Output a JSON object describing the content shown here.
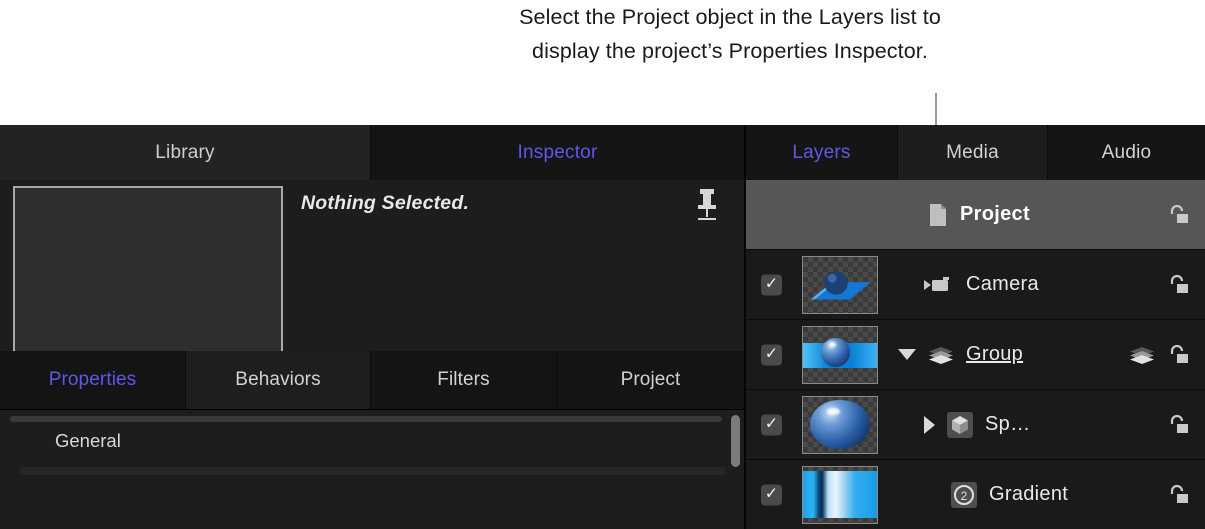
{
  "callout": {
    "text": "Select the Project object in the Layers list to display the project’s Properties Inspector."
  },
  "left_pane": {
    "top_tabs": [
      {
        "label": "Library",
        "active": false
      },
      {
        "label": "Inspector",
        "active": true
      }
    ],
    "inspector": {
      "status_text": "Nothing Selected.",
      "pin_icon": "pushpin-icon",
      "preview_placeholder": ""
    },
    "bottom_tabs": [
      {
        "label": "Properties",
        "active": true
      },
      {
        "label": "Behaviors",
        "active": false
      },
      {
        "label": "Filters",
        "active": false
      },
      {
        "label": "Project",
        "active": false
      }
    ],
    "properties_panel": {
      "section_label": "General"
    }
  },
  "right_pane": {
    "tabs": [
      {
        "label": "Layers",
        "active": true
      },
      {
        "label": "Media",
        "active": false
      },
      {
        "label": "Audio",
        "active": false
      }
    ],
    "layers": [
      {
        "label": "Project",
        "selected": true,
        "has_checkbox": false,
        "has_thumbnail": false,
        "disclosure": "none",
        "type_icon": "document-icon",
        "right_icons": [
          "unlock-icon"
        ],
        "underlined": false
      },
      {
        "label": "Camera",
        "selected": false,
        "has_checkbox": true,
        "checked": true,
        "has_thumbnail": true,
        "thumbnail": "camera-scene-thumbnail",
        "disclosure": "none",
        "type_icon": "camera-icon",
        "right_icons": [
          "unlock-icon"
        ],
        "underlined": false
      },
      {
        "label": "Group",
        "selected": false,
        "has_checkbox": true,
        "checked": true,
        "has_thumbnail": true,
        "thumbnail": "group-scene-thumbnail",
        "disclosure": "down",
        "type_icon": "group-layers-icon",
        "right_icons": [
          "group-layers-icon",
          "unlock-icon"
        ],
        "underlined": true
      },
      {
        "label": "Sp…",
        "selected": false,
        "has_checkbox": true,
        "checked": true,
        "has_thumbnail": true,
        "thumbnail": "sphere-thumbnail",
        "disclosure": "right",
        "type_icon": "3d-cube-icon",
        "right_icons": [
          "unlock-icon"
        ],
        "underlined": false
      },
      {
        "label": "Gradient",
        "selected": false,
        "has_checkbox": true,
        "checked": true,
        "has_thumbnail": true,
        "thumbnail": "gradient-thumbnail",
        "disclosure": "none",
        "type_icon": "2d-badge-icon",
        "right_icons": [
          "unlock-icon"
        ],
        "underlined": false
      }
    ]
  },
  "colors": {
    "accent_blue": "#6157e6",
    "selected_row": "#565656",
    "panel_bg": "#1a1a1a",
    "tabbar_bg": "#151515",
    "text": "#e9e9e9"
  },
  "checkmark_glyph": "✓"
}
